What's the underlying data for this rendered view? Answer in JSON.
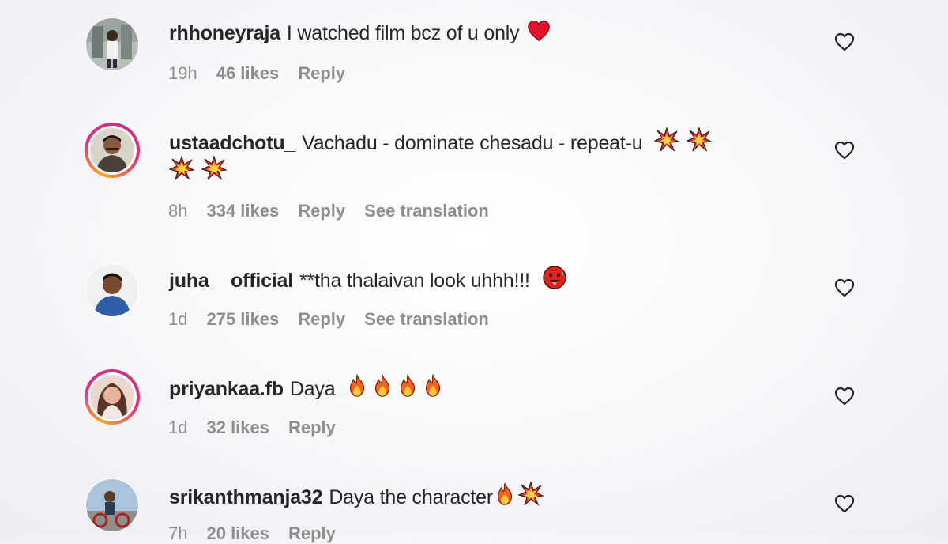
{
  "comments": [
    {
      "username": "rhhoneyraja",
      "text": "I watched film bcz of u only",
      "emojis": [
        "red-heart"
      ],
      "time": "19h",
      "likes": "46 likes",
      "reply": "Reply",
      "translation": "",
      "avatar_ring": false
    },
    {
      "username": "ustaadchotu_",
      "text": "Vachadu - dominate chesadu - repeat-u",
      "emojis": [
        "collision",
        "collision",
        "collision",
        "collision"
      ],
      "time": "8h",
      "likes": "334 likes",
      "reply": "Reply",
      "translation": "See translation",
      "avatar_ring": true
    },
    {
      "username": "juha__official",
      "text": "**tha thalaivan look uhhh!!!",
      "emojis": [
        "hot-face"
      ],
      "time": "1d",
      "likes": "275 likes",
      "reply": "Reply",
      "translation": "See translation",
      "avatar_ring": false
    },
    {
      "username": "priyankaa.fb",
      "text": "Daya",
      "emojis": [
        "fire",
        "fire",
        "fire",
        "fire"
      ],
      "time": "1d",
      "likes": "32 likes",
      "reply": "Reply",
      "translation": "",
      "avatar_ring": true
    },
    {
      "username": "srikanthmanja32",
      "text": "Daya the character",
      "emojis": [
        "fire",
        "collision"
      ],
      "time": "7h",
      "likes": "20 likes",
      "reply": "Reply",
      "translation": "",
      "avatar_ring": false
    }
  ],
  "colors": {
    "text": "#262626",
    "meta": "#8e8e8e",
    "ring_start": "#f9a825",
    "ring_end": "#c13584"
  }
}
